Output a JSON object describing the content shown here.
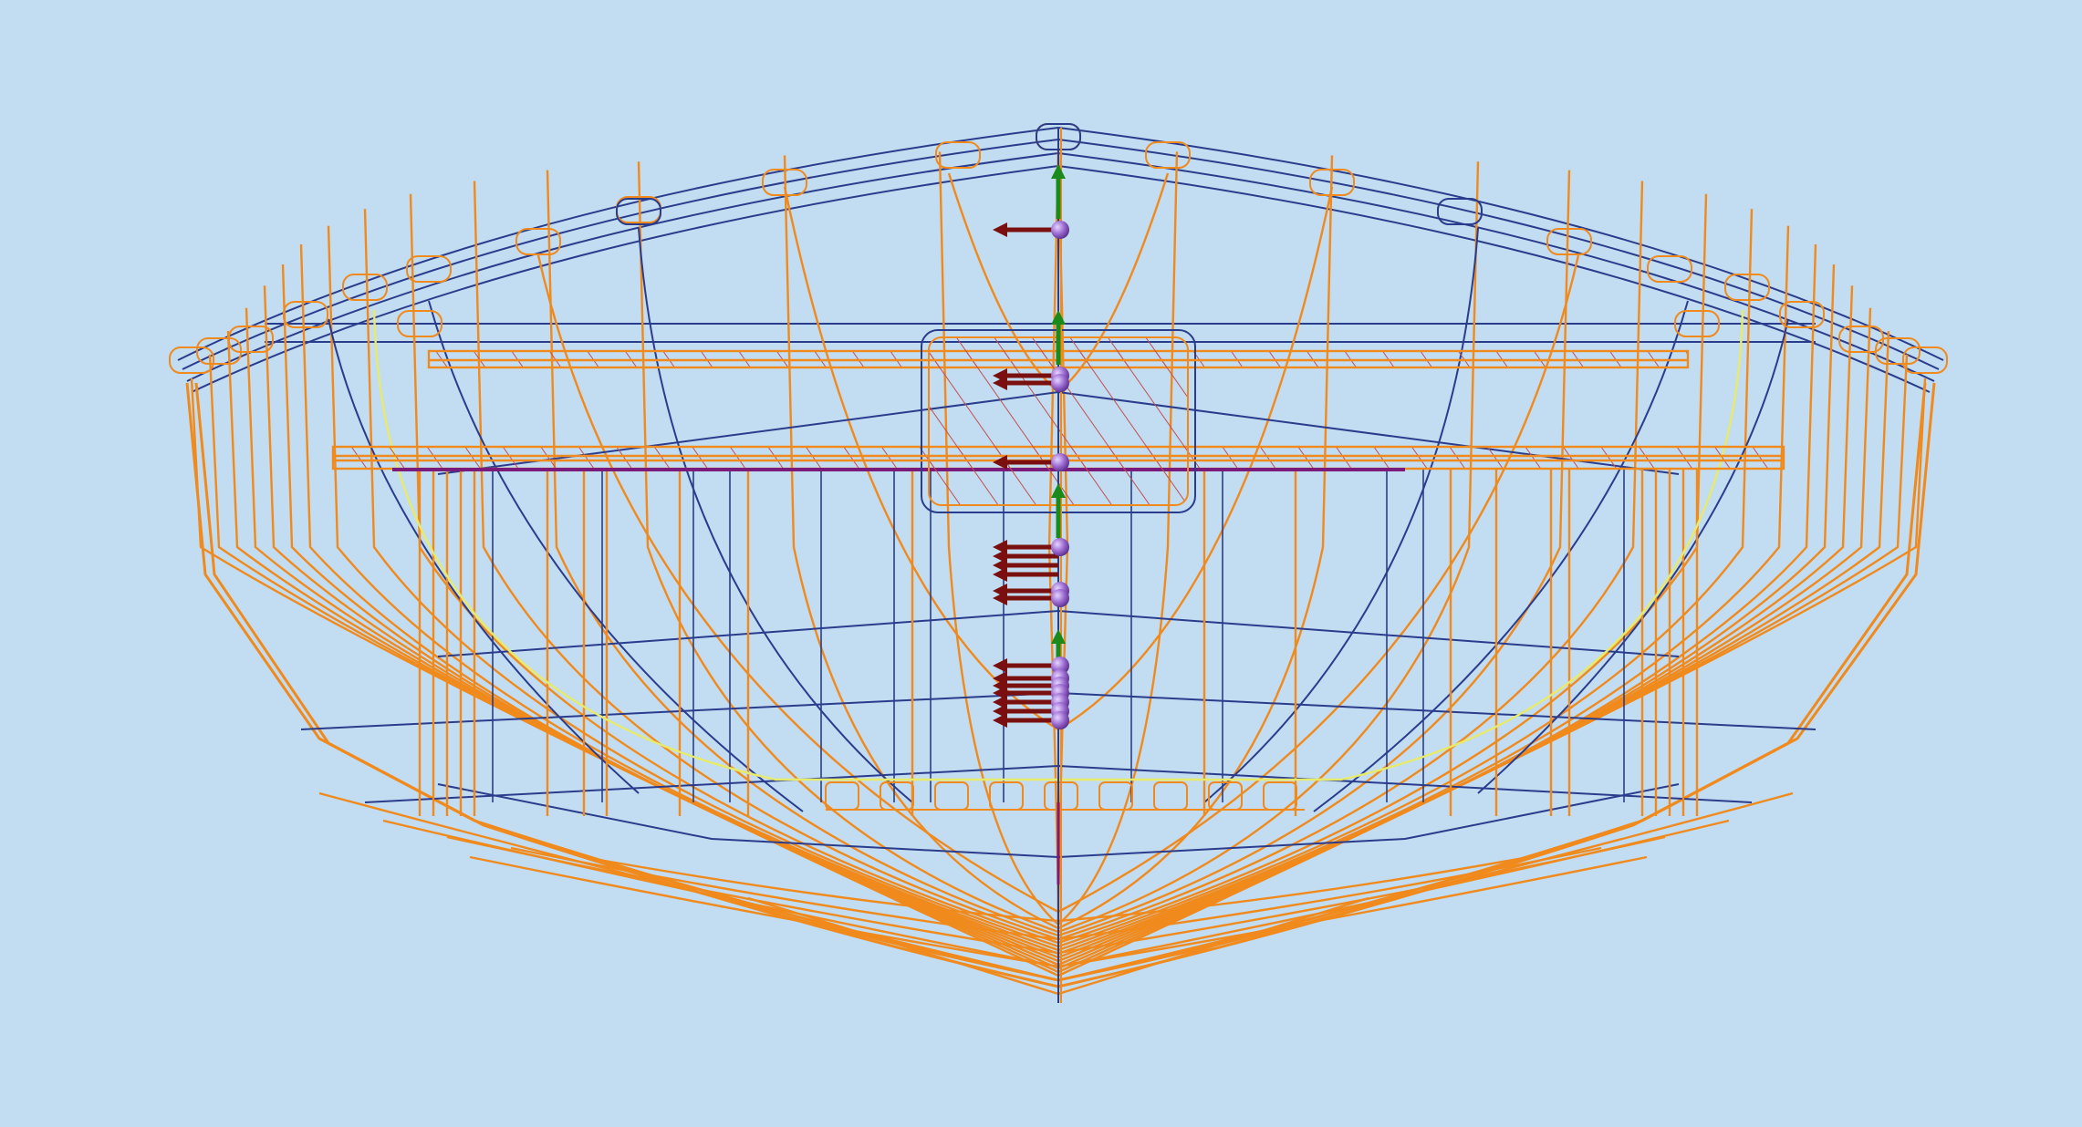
{
  "viewport": {
    "background": "#c2dcf2"
  },
  "colors": {
    "frame_orange": "#f08a1c",
    "structure_blue": "#2a3c8c",
    "guide_yellow": "#e8ea6a",
    "load_arrow": "#7a0f0f",
    "axis_arrow": "#1a8a1a",
    "node_sphere": "#9a6ad0",
    "deck_purple": "#7a1a7a",
    "hatch_red": "#c05050"
  },
  "icons": {
    "load_marker": "horizontal-load-arrow-icon",
    "axis_marker": "vertical-axis-arrow-icon",
    "node_marker": "node-sphere-icon"
  }
}
